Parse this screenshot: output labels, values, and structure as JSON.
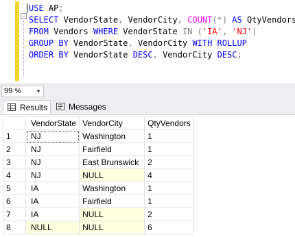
{
  "editor": {
    "lines": [
      [
        {
          "t": "USE",
          "c": "kw"
        },
        {
          "t": " AP"
        },
        {
          "t": ";",
          "c": "op"
        }
      ],
      [
        {
          "t": "SELECT",
          "c": "kw"
        },
        {
          "t": " VendorState"
        },
        {
          "t": ",",
          "c": "op"
        },
        {
          "t": " VendorCity"
        },
        {
          "t": ",",
          "c": "op"
        },
        {
          "t": " "
        },
        {
          "t": "COUNT",
          "c": "fn"
        },
        {
          "t": "(*)",
          "c": "op"
        },
        {
          "t": " "
        },
        {
          "t": "AS",
          "c": "kw"
        },
        {
          "t": " QtyVendors"
        }
      ],
      [
        {
          "t": "FROM",
          "c": "kw"
        },
        {
          "t": " Vendors "
        },
        {
          "t": "WHERE",
          "c": "kw"
        },
        {
          "t": " VendorState "
        },
        {
          "t": "IN",
          "c": "op"
        },
        {
          "t": " "
        },
        {
          "t": "(",
          "c": "op"
        },
        {
          "t": "'IA'",
          "c": "str"
        },
        {
          "t": ",",
          "c": "op"
        },
        {
          "t": " "
        },
        {
          "t": "'NJ'",
          "c": "str"
        },
        {
          "t": ")",
          "c": "op"
        }
      ],
      [
        {
          "t": "GROUP BY",
          "c": "kw"
        },
        {
          "t": " VendorState"
        },
        {
          "t": ",",
          "c": "op"
        },
        {
          "t": " VendorCity "
        },
        {
          "t": "WITH ROLLUP",
          "c": "kw"
        }
      ],
      [
        {
          "t": "ORDER BY",
          "c": "kw"
        },
        {
          "t": " VendorState "
        },
        {
          "t": "DESC",
          "c": "kw"
        },
        {
          "t": ",",
          "c": "op"
        },
        {
          "t": " VendorCity "
        },
        {
          "t": "DESC",
          "c": "kw"
        },
        {
          "t": ";",
          "c": "op"
        }
      ]
    ],
    "fold_symbol": "−"
  },
  "zoom": {
    "value": "99 %",
    "arrow": "▼"
  },
  "tabs": {
    "results_label": "Results",
    "messages_label": "Messages"
  },
  "grid": {
    "headers": [
      "VendorState",
      "VendorCity",
      "QtyVendors"
    ],
    "rows": [
      {
        "n": "1",
        "state": "NJ",
        "city": "Washington",
        "qty": "1"
      },
      {
        "n": "2",
        "state": "NJ",
        "city": "Fairfield",
        "qty": "1"
      },
      {
        "n": "3",
        "state": "NJ",
        "city": "East Brunswick",
        "qty": "2"
      },
      {
        "n": "4",
        "state": "NJ",
        "city": "NULL",
        "qty": "4"
      },
      {
        "n": "5",
        "state": "IA",
        "city": "Washington",
        "qty": "1"
      },
      {
        "n": "6",
        "state": "IA",
        "city": "Fairfield",
        "qty": "1"
      },
      {
        "n": "7",
        "state": "IA",
        "city": "NULL",
        "qty": "2"
      },
      {
        "n": "8",
        "state": "NULL",
        "city": "NULL",
        "qty": "6"
      }
    ],
    "null_text": "NULL"
  },
  "colors": {
    "keyword": "#0000ff",
    "function": "#ff00ff",
    "string": "#ff0000",
    "operator": "#808080",
    "null_cell_bg": "#ffffe1",
    "gutter_bar": "#f2d531"
  }
}
